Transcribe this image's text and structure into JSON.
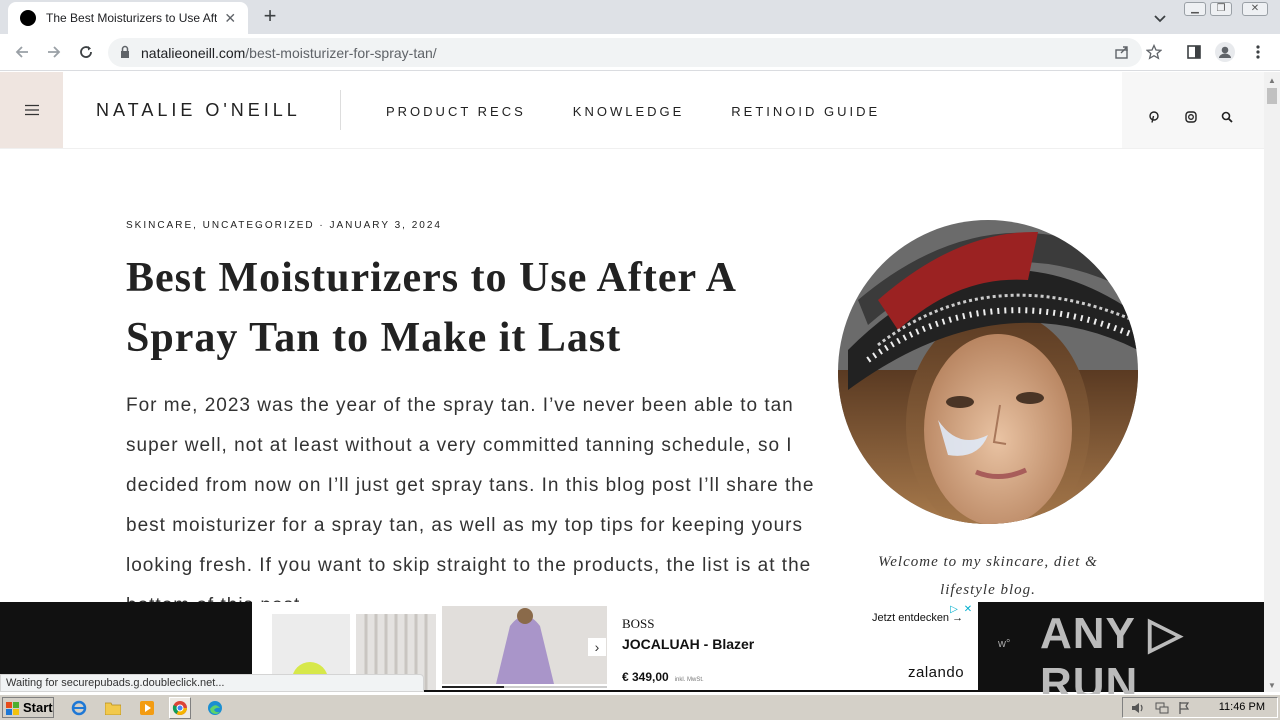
{
  "browser": {
    "tab_title": "The Best Moisturizers to Use After A Spray Tan to Make it Last",
    "tab_close": "✕",
    "new_tab": "+",
    "url_domain": "natalieoneill.com",
    "url_path": "/best-moisturizer-for-spray-tan/",
    "status_text": "Waiting for securepubads.g.doubleclick.net..."
  },
  "site": {
    "logo": "NATALIE O'NEILL",
    "nav": [
      "PRODUCT RECS",
      "KNOWLEDGE",
      "RETINOID GUIDE"
    ]
  },
  "post": {
    "meta": "SKINCARE, UNCATEGORIZED · JANUARY 3, 2024",
    "title": "Best Moisturizers to Use After A Spray Tan to Make it Last",
    "body": "For me, 2023 was the year of the spray tan. I’ve never been able to tan super well, not at least without a very committed tanning schedule, so I decided from now on I’ll just get spray tans. In this blog post I’ll share the best moisturizer for a spray tan, as well as my top tips for keeping yours looking fresh. If you want to skip straight to the products, the list is at the bottom of this post."
  },
  "sidebar": {
    "welcome": "Welcome to my skincare, diet & lifestyle blog."
  },
  "ad": {
    "brand": "BOSS",
    "product": "JOCALUAH - Blazer",
    "price": "€ 349,00",
    "price_note": "inkl. MwSt.",
    "cta": "Jetzt entdecken",
    "cta_arrow": "→",
    "retailer": "zalando",
    "next_arrow": "›",
    "choices_icon": "▷",
    "close_icon": "✕",
    "watermark": "ANY ▷ RUN",
    "side_text": "ԝ°"
  },
  "taskbar": {
    "start": "Start",
    "clock": "11:46 PM"
  },
  "colors": {
    "header_accent": "#efe5e0",
    "tabbar": "#dee1e6",
    "taskbar": "#d4d0c8"
  }
}
